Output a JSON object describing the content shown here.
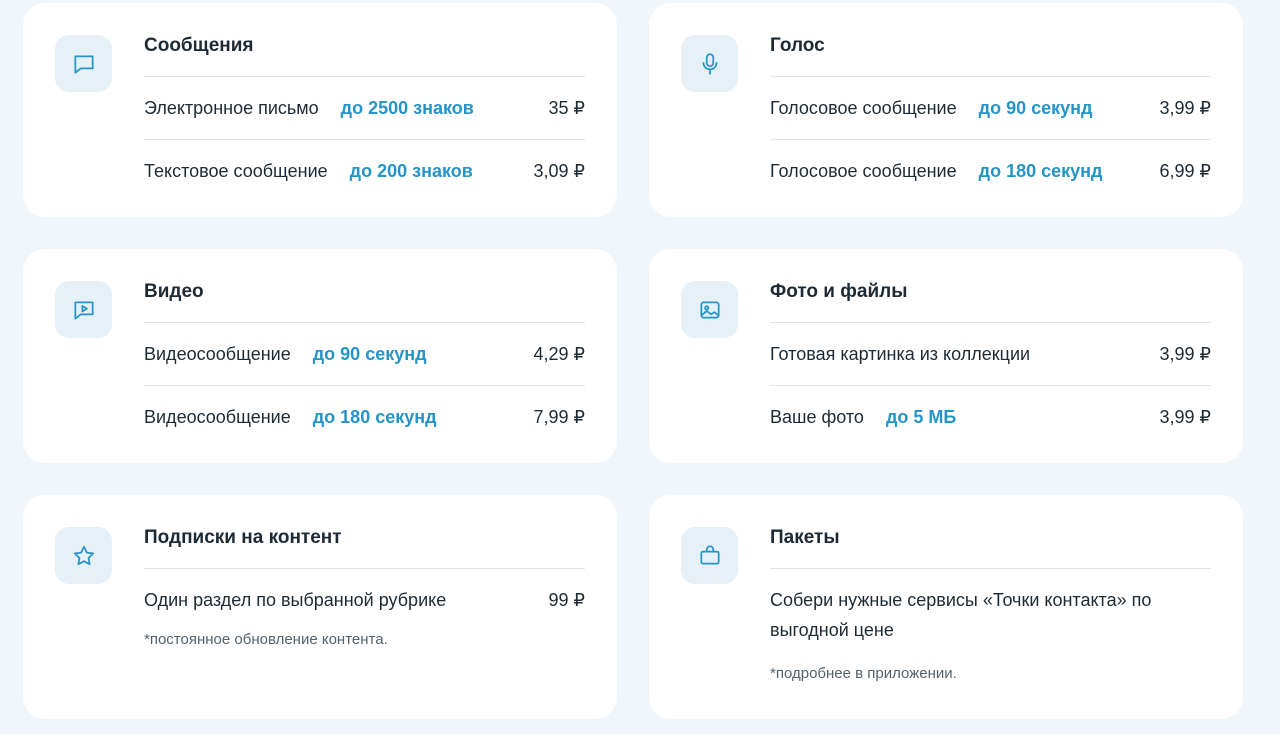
{
  "cards": {
    "messages": {
      "title": "Сообщения",
      "icon": "chat-bubble-icon",
      "rows": [
        {
          "label": "Электронное письмо",
          "limit": "до 2500 знаков",
          "price": "35 ₽"
        },
        {
          "label": "Текстовое сообщение",
          "limit": "до 200 знаков",
          "price": "3,09 ₽"
        }
      ]
    },
    "voice": {
      "title": "Голос",
      "icon": "microphone-icon",
      "rows": [
        {
          "label": "Голосовое сообщение",
          "limit": "до 90 секунд",
          "price": "3,99 ₽"
        },
        {
          "label": "Голосовое сообщение",
          "limit": "до 180 секунд",
          "price": "6,99 ₽"
        }
      ]
    },
    "video": {
      "title": "Видео",
      "icon": "video-message-icon",
      "rows": [
        {
          "label": "Видеосообщение",
          "limit": "до 90 секунд",
          "price": "4,29 ₽"
        },
        {
          "label": "Видеосообщение",
          "limit": "до 180 секунд",
          "price": "7,99 ₽"
        }
      ]
    },
    "photos": {
      "title": "Фото и файлы",
      "icon": "image-icon",
      "rows": [
        {
          "label": "Готовая картинка из коллекции",
          "limit": "",
          "price": "3,99 ₽"
        },
        {
          "label": "Ваше фото",
          "limit": "до 5 МБ",
          "price": "3,99 ₽"
        }
      ]
    },
    "subscriptions": {
      "title": "Подписки на контент",
      "icon": "star-icon",
      "rows": [
        {
          "label": "Один раздел по выбранной рубрике",
          "price": "99 ₽"
        }
      ],
      "note": "*постоянное обновление контента."
    },
    "packages": {
      "title": "Пакеты",
      "icon": "shopping-bag-icon",
      "description": "Собери нужные сервисы «Точки контакта» по выгодной цене",
      "note": "*подробнее в приложении."
    }
  },
  "colors": {
    "background": "#f1f6fa",
    "card": "#ffffff",
    "icon_bg": "#e6f0f7",
    "accent": "#2595c7",
    "text": "#1e2a33"
  }
}
